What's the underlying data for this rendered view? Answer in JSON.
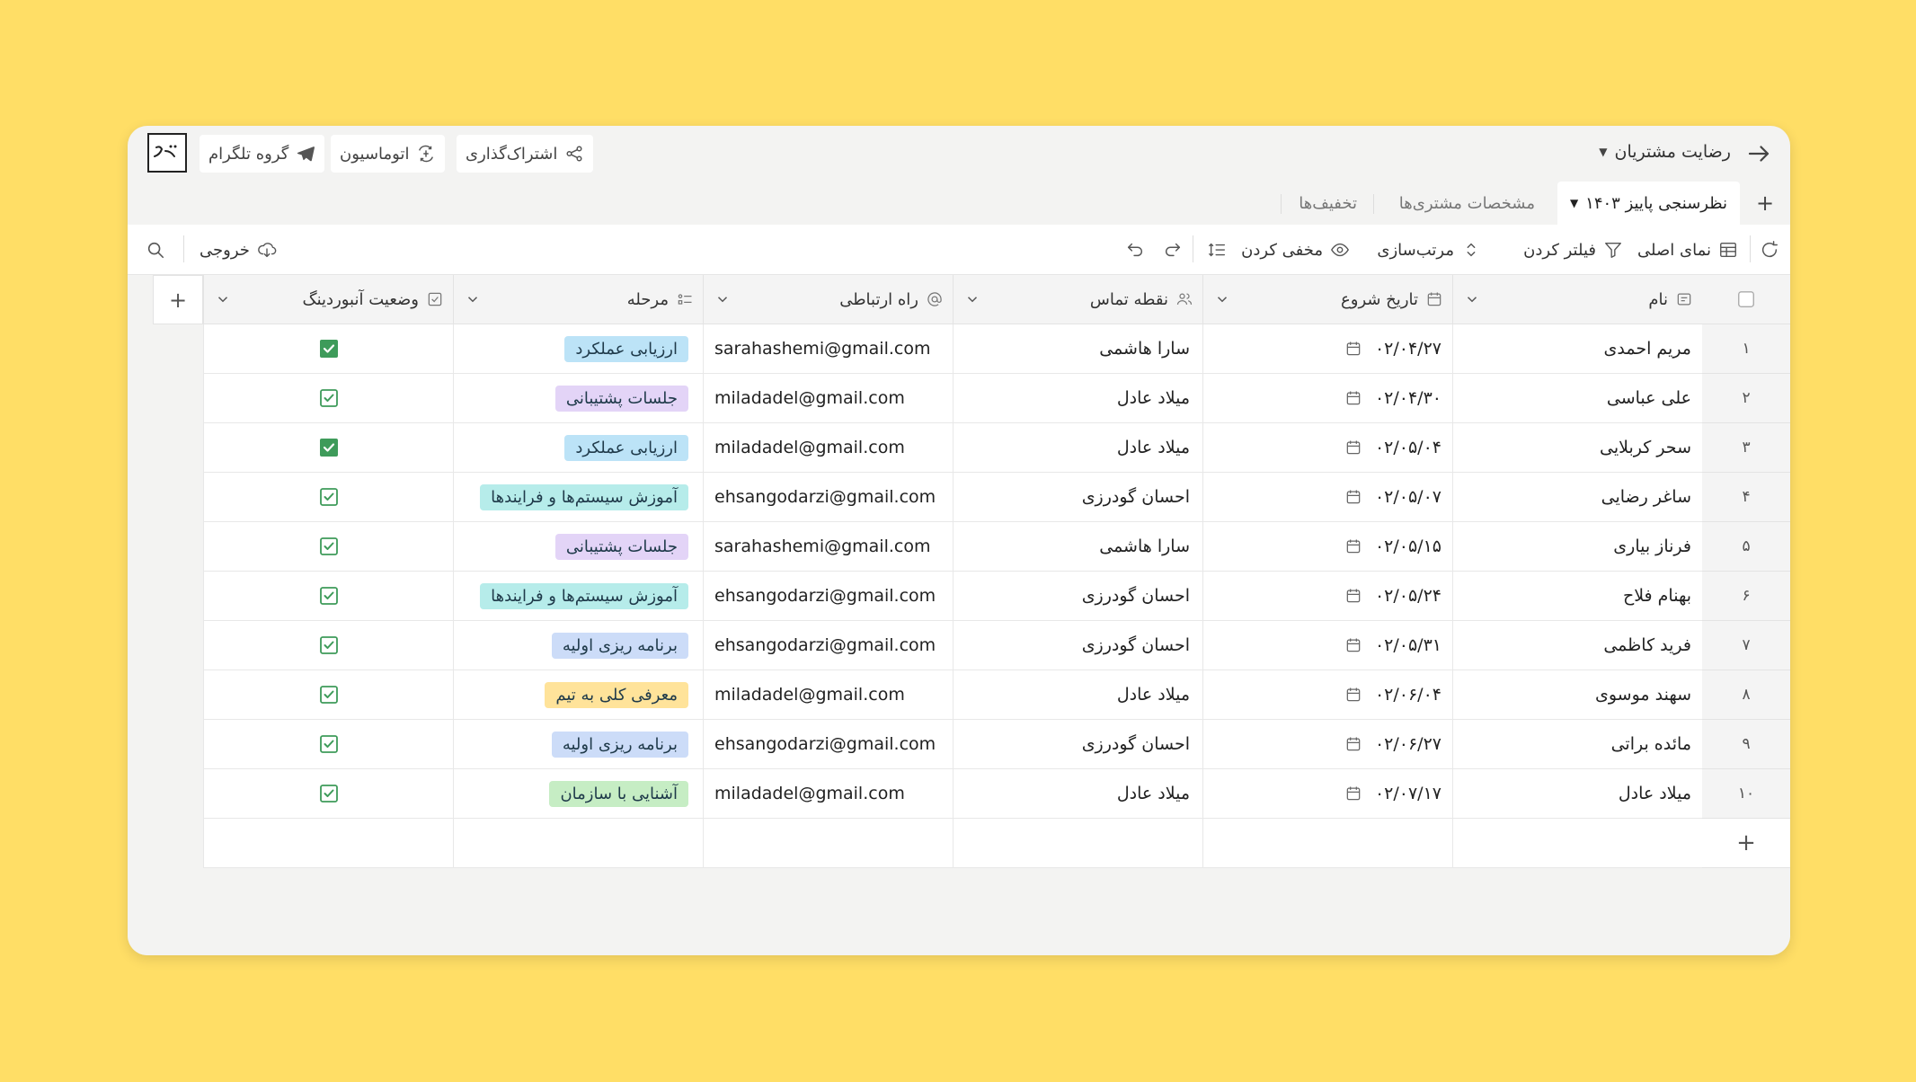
{
  "app": {
    "base_title": "رضایت مشتریان",
    "share_label": "اشتراک‌گذاری",
    "automation_label": "اتوماسیون",
    "telegram_label": "گروه تلگرام",
    "logo_text": "رژ"
  },
  "tabs": [
    {
      "label": "نظرسنجی پاییز ۱۴۰۳"
    },
    {
      "label": "مشخصات مشتری‌ها"
    },
    {
      "label": "تخفیف‌ها"
    }
  ],
  "tab_add": "+",
  "toolbar": {
    "main_view": "نمای اصلی",
    "filter": "فیلتر کردن",
    "sort": "مرتب‌سازی",
    "hide": "مخفی کردن",
    "export": "خروجی"
  },
  "columns": [
    {
      "label": "نام",
      "icon": "text-icon"
    },
    {
      "label": "تاریخ شروع",
      "icon": "calendar-icon"
    },
    {
      "label": "نقطه تماس",
      "icon": "people-icon"
    },
    {
      "label": "راه ارتباطی",
      "icon": "at-icon"
    },
    {
      "label": "مرحله",
      "icon": "select-icon"
    },
    {
      "label": "وضعیت آنبوردینگ",
      "icon": "checkbox-icon"
    }
  ],
  "add_row_label": "+",
  "add_col_label": "+",
  "rows": [
    {
      "num": "۱",
      "name": "مریم احمدی",
      "date": "۰۲/۰۴/۲۷",
      "contact": "سارا هاشمی",
      "email": "sarahashemi@gmail.com",
      "stage": "ارزیابی عملکرد",
      "stage_color": "#BCE3F7",
      "checked": "filled"
    },
    {
      "num": "۲",
      "name": "علی عباسی",
      "date": "۰۲/۰۴/۳۰",
      "contact": "میلاد عادل",
      "email": "miladadel@gmail.com",
      "stage": "جلسات پشتیبانی",
      "stage_color": "#E3D4F7",
      "checked": "outline"
    },
    {
      "num": "۳",
      "name": "سحر کربلایی",
      "date": "۰۲/۰۵/۰۴",
      "contact": "میلاد عادل",
      "email": "miladadel@gmail.com",
      "stage": "ارزیابی عملکرد",
      "stage_color": "#BCE3F7",
      "checked": "filled"
    },
    {
      "num": "۴",
      "name": "ساغر رضایی",
      "date": "۰۲/۰۵/۰۷",
      "contact": "احسان گودرزی",
      "email": "ehsangodarzi@gmail.com",
      "stage": "آموزش سیستم‌ها و فرایندها",
      "stage_color": "#B6ECEA",
      "checked": "outline"
    },
    {
      "num": "۵",
      "name": "فرناز بیاری",
      "date": "۰۲/۰۵/۱۵",
      "contact": "سارا هاشمی",
      "email": "sarahashemi@gmail.com",
      "stage": "جلسات پشتیبانی",
      "stage_color": "#E3D4F7",
      "checked": "outline"
    },
    {
      "num": "۶",
      "name": "بهنام فلاح",
      "date": "۰۲/۰۵/۲۴",
      "contact": "احسان گودرزی",
      "email": "ehsangodarzi@gmail.com",
      "stage": "آموزش سیستم‌ها و فرایندها",
      "stage_color": "#B6ECEA",
      "checked": "outline"
    },
    {
      "num": "۷",
      "name": "فرید کاظمی",
      "date": "۰۲/۰۵/۳۱",
      "contact": "احسان گودرزی",
      "email": "ehsangodarzi@gmail.com",
      "stage": "برنامه ریزی اولیه",
      "stage_color": "#CCDCF8",
      "checked": "outline"
    },
    {
      "num": "۸",
      "name": "سهند موسوی",
      "date": "۰۲/۰۶/۰۴",
      "contact": "میلاد عادل",
      "email": "miladadel@gmail.com",
      "stage": "معرفی کلی به تیم",
      "stage_color": "#FFE39A",
      "checked": "outline"
    },
    {
      "num": "۹",
      "name": "مائده براتی",
      "date": "۰۲/۰۶/۲۷",
      "contact": "احسان گودرزی",
      "email": "ehsangodarzi@gmail.com",
      "stage": "برنامه ریزی اولیه",
      "stage_color": "#CCDCF8",
      "checked": "outline"
    },
    {
      "num": "۱۰",
      "name": "میلاد عادل",
      "date": "۰۲/۰۷/۱۷",
      "contact": "میلاد عادل",
      "email": "miladadel@gmail.com",
      "stage": "آشنایی با سازمان",
      "stage_color": "#C6EDC4",
      "checked": "outline"
    }
  ],
  "colors": {
    "background": "#FFDE66",
    "checkbox_green": "#3E9B5A"
  }
}
